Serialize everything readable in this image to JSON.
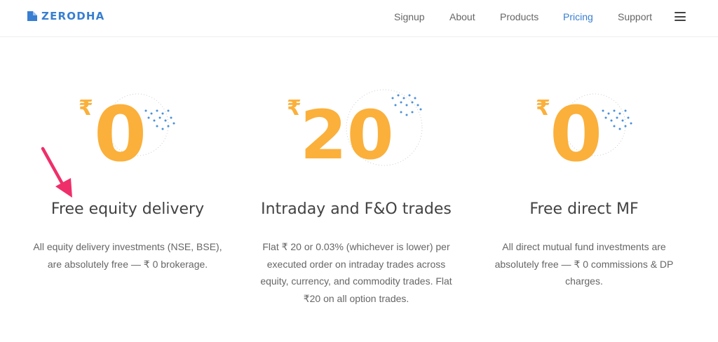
{
  "brand": {
    "name": "ZERODHA",
    "logo_color": "#387ed1"
  },
  "nav": {
    "items": [
      {
        "label": "Signup",
        "active": false
      },
      {
        "label": "About",
        "active": false
      },
      {
        "label": "Products",
        "active": false
      },
      {
        "label": "Pricing",
        "active": true
      },
      {
        "label": "Support",
        "active": false
      }
    ],
    "menu_icon": "hamburger-menu-icon"
  },
  "cards": [
    {
      "currency": "₹",
      "amount": "0",
      "title": "Free equity delivery",
      "description_lines": [
        "All equity delivery investments (NSE, BSE),",
        "are absolutely free — ₹ 0 brokerage."
      ]
    },
    {
      "currency": "₹",
      "amount": "20",
      "title": "Intraday and F&O trades",
      "description_lines": [
        "Flat ₹ 20 or 0.03% (whichever is lower) per",
        "executed order on intraday trades across",
        "equity, currency, and commodity trades. Flat",
        "₹20 on all option trades."
      ]
    },
    {
      "currency": "₹",
      "amount": "0",
      "title": "Free direct MF",
      "description_lines": [
        "All direct mutual fund investments are",
        "absolutely free — ₹ 0 commissions & DP",
        "charges."
      ]
    }
  ],
  "colors": {
    "accent": "#387ed1",
    "price": "#fbb03b",
    "annotation_arrow": "#ef2f6a",
    "dots": "#4a90d9"
  }
}
